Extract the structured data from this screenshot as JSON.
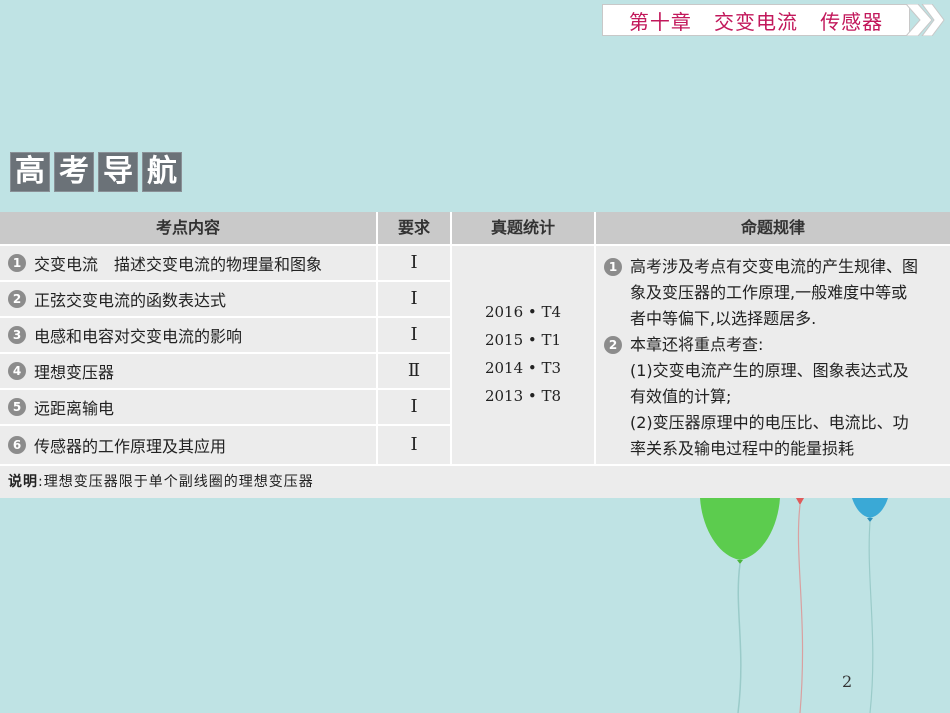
{
  "banner": {
    "chapter": "第十章",
    "topic1": "交变电流",
    "topic2": "传感器"
  },
  "section_title": [
    "高",
    "考",
    "导",
    "航"
  ],
  "table": {
    "headers": [
      "考点内容",
      "要求",
      "真题统计",
      "命题规律"
    ],
    "rows": [
      {
        "num": "1",
        "content": "交变电流　描述交变电流的物理量和图象",
        "req": "Ⅰ"
      },
      {
        "num": "2",
        "content": "正弦交变电流的函数表达式",
        "req": "Ⅰ"
      },
      {
        "num": "3",
        "content": "电感和电容对交变电流的影响",
        "req": "Ⅰ"
      },
      {
        "num": "4",
        "content": "理想变压器",
        "req": "Ⅱ"
      },
      {
        "num": "5",
        "content": "远距离输电",
        "req": "Ⅰ"
      },
      {
        "num": "6",
        "content": "传感器的工作原理及其应用",
        "req": "Ⅰ"
      }
    ],
    "stats": [
      "2016 • T4",
      "2015 • T1",
      "2014 • T3",
      "2013 • T8"
    ],
    "rules": {
      "r1_num": "1",
      "r1_lines": [
        "高考涉及考点有交变电流的产生规律、图",
        "象及变压器的工作原理,一般难度中等或",
        "者中等偏下,以选择题居多."
      ],
      "r2_num": "2",
      "r2_lines": [
        "本章还将重点考查:",
        "(1)交变电流产生的原理、图象表达式及",
        "有效值的计算;",
        "(2)变压器原理中的电压比、电流比、功",
        "率关系及输电过程中的能量损耗"
      ]
    },
    "note_label": "说明",
    "note_text": ":理想变压器限于单个副线圈的理想变压器"
  },
  "page_number": "2",
  "colors": {
    "background": "#bfe3e4",
    "banner_text": "#c2185b",
    "balloon_green": "#5ccc4e",
    "balloon_blue": "#3aa9d6"
  }
}
